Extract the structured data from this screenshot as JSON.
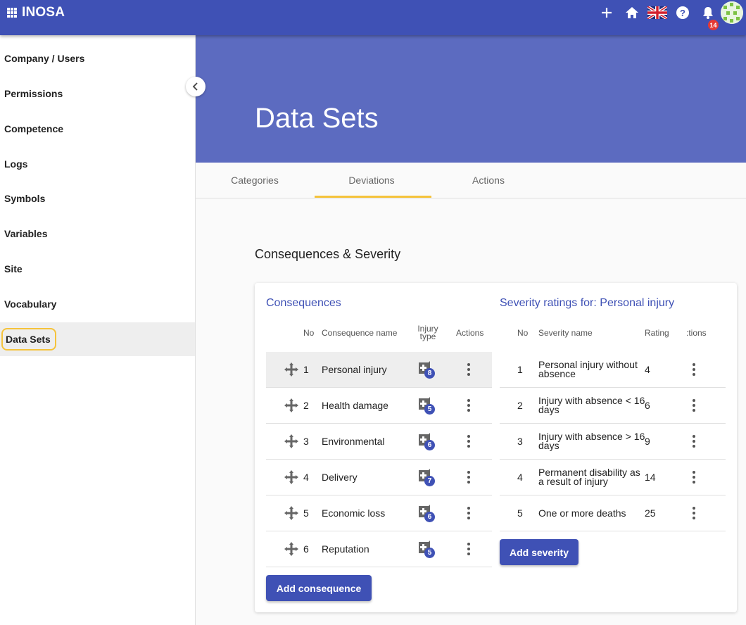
{
  "app": {
    "name": "INOSA",
    "notifications": "14"
  },
  "topbar_icons": [
    "plus-icon",
    "home-icon",
    "uk-flag-icon",
    "help-icon",
    "bell-icon"
  ],
  "sidebar": {
    "items": [
      {
        "label": "Company / Users"
      },
      {
        "label": "Permissions"
      },
      {
        "label": "Competence"
      },
      {
        "label": "Logs"
      },
      {
        "label": "Symbols"
      },
      {
        "label": "Variables"
      },
      {
        "label": "Site"
      },
      {
        "label": "Vocabulary"
      },
      {
        "label": "Data Sets",
        "active": true
      }
    ]
  },
  "page": {
    "title": "Data Sets",
    "section": "Consequences & Severity"
  },
  "tabs": [
    {
      "label": "Categories"
    },
    {
      "label": "Deviations",
      "active": true
    },
    {
      "label": "Actions"
    }
  ],
  "consequences": {
    "title": "Consequences",
    "headers": {
      "no": "No",
      "name": "Consequence name",
      "injury": "Injury type",
      "actions": "Actions"
    },
    "rows": [
      {
        "no": "1",
        "name": "Personal injury",
        "count": "8"
      },
      {
        "no": "2",
        "name": "Health damage",
        "count": "5"
      },
      {
        "no": "3",
        "name": "Environmental",
        "count": "6"
      },
      {
        "no": "4",
        "name": "Delivery",
        "count": "7"
      },
      {
        "no": "5",
        "name": "Economic loss",
        "count": "6"
      },
      {
        "no": "6",
        "name": "Reputation",
        "count": "5"
      }
    ],
    "add_label": "Add consequence"
  },
  "severity": {
    "title": "Severity ratings for: Personal injury",
    "headers": {
      "no": "No",
      "name": "Severity name",
      "rating": "Rating",
      "actions": ":tions"
    },
    "rows": [
      {
        "no": "1",
        "name": "Personal injury without absence",
        "rating": "4"
      },
      {
        "no": "2",
        "name": "Injury with absence < 16 days",
        "rating": "6"
      },
      {
        "no": "3",
        "name": "Injury with absence > 16 days",
        "rating": "9"
      },
      {
        "no": "4",
        "name": "Permanent disability as a result of injury",
        "rating": "14"
      },
      {
        "no": "5",
        "name": "One or more deaths",
        "rating": "25"
      }
    ],
    "add_label": "Add severity"
  }
}
